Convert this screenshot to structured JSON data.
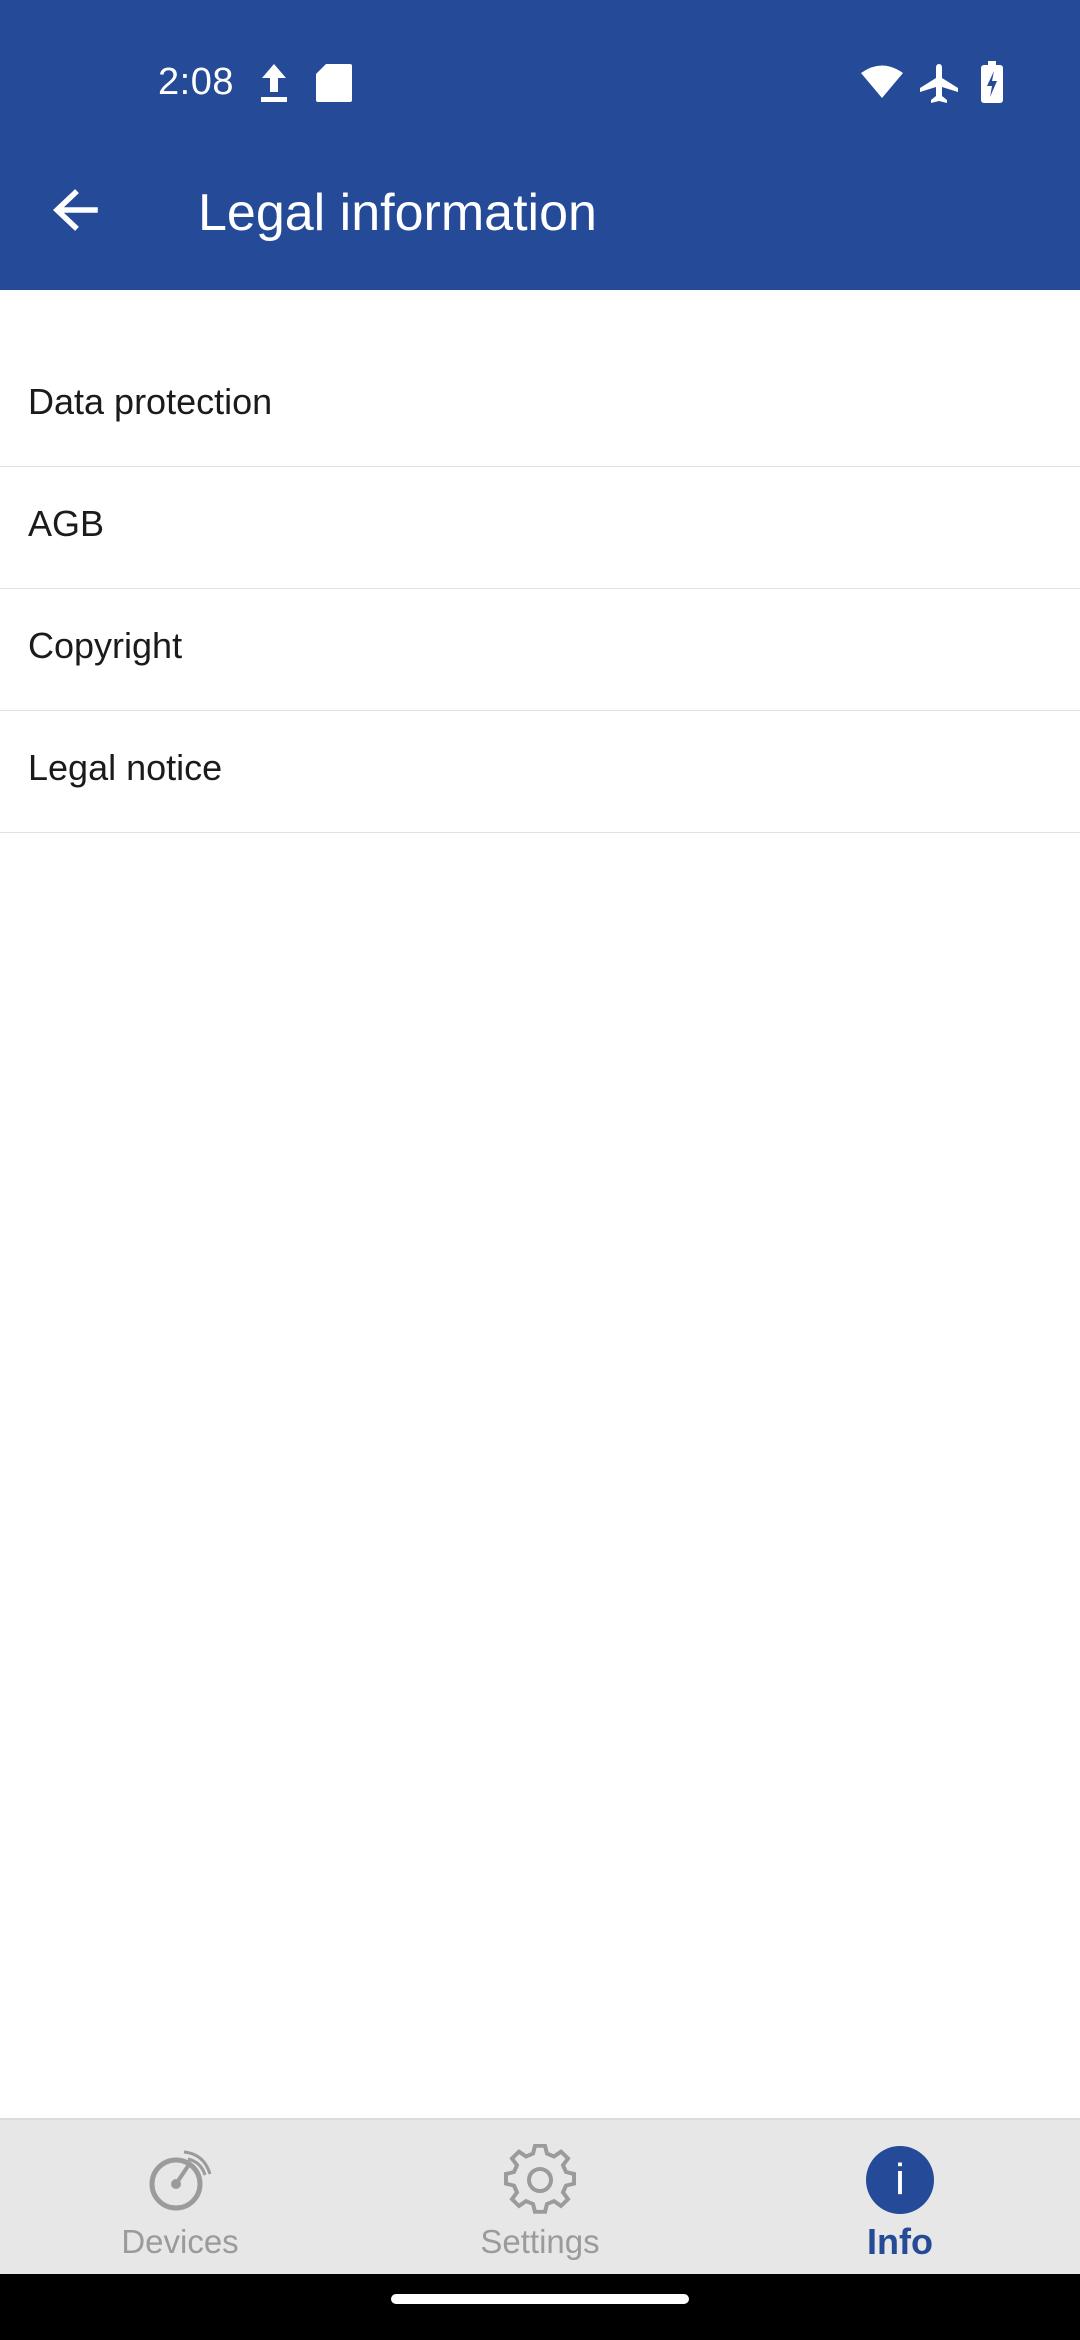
{
  "status_bar": {
    "time": "2:08",
    "icons": [
      "upload-icon",
      "sd-card-icon",
      "wifi-icon",
      "airplane-icon",
      "battery-charging-icon"
    ]
  },
  "header": {
    "title": "Legal information",
    "back_icon": "arrow-left-icon"
  },
  "list": {
    "items": [
      {
        "label": "Data protection"
      },
      {
        "label": "AGB"
      },
      {
        "label": "Copyright"
      },
      {
        "label": "Legal notice"
      }
    ]
  },
  "bottom_nav": {
    "tabs": [
      {
        "label": "Devices",
        "icon": "gauge-icon",
        "active": false
      },
      {
        "label": "Settings",
        "icon": "gear-icon",
        "active": false
      },
      {
        "label": "Info",
        "icon": "info-icon",
        "icon_text": "i",
        "active": true
      }
    ]
  },
  "colors": {
    "primary": "#244a98",
    "nav_background": "#e7e7e7",
    "inactive": "#9b9b9b",
    "divider": "#e2e2e2"
  }
}
